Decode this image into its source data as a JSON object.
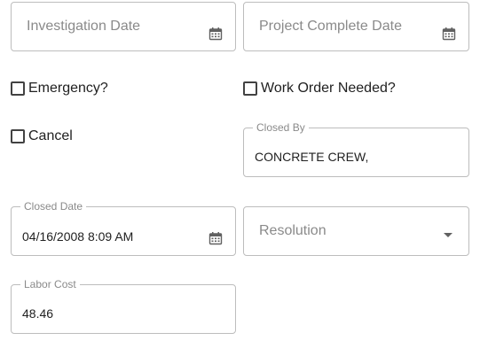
{
  "form": {
    "investigation_date": {
      "placeholder": "Investigation Date",
      "value": "",
      "icon": "calendar-icon"
    },
    "project_complete_date": {
      "placeholder": "Project Complete Date",
      "value": "",
      "icon": "calendar-icon"
    },
    "emergency": {
      "label": "Emergency?",
      "checked": false
    },
    "work_order_needed": {
      "label": "Work Order Needed?",
      "checked": false
    },
    "cancel": {
      "label": "Cancel",
      "checked": false
    },
    "closed_by": {
      "label": "Closed By",
      "value": "CONCRETE CREW,"
    },
    "closed_date": {
      "label": "Closed Date",
      "value": "04/16/2008 8:09 AM",
      "icon": "calendar-icon"
    },
    "resolution": {
      "placeholder": "Resolution",
      "value": "",
      "icon": "chevron-down-icon"
    },
    "labor_cost": {
      "label": "Labor Cost",
      "value": "48.46"
    }
  },
  "colors": {
    "border": "#bdbdbd",
    "label": "#8a8a8a",
    "text": "#212121"
  }
}
